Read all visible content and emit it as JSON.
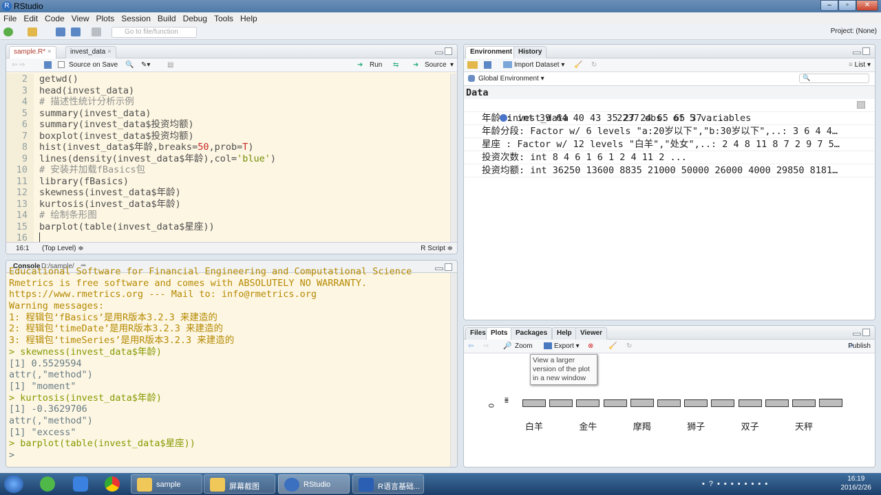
{
  "window": {
    "title": "RStudio"
  },
  "menu": [
    "File",
    "Edit",
    "Code",
    "View",
    "Plots",
    "Session",
    "Build",
    "Debug",
    "Tools",
    "Help"
  ],
  "toolbar": {
    "goto_placeholder": "Go to file/function",
    "project": "Project: (None)"
  },
  "editor": {
    "tabs": [
      {
        "label": "sample.R*",
        "active": true
      },
      {
        "label": "invest_data",
        "active": false
      }
    ],
    "source_on_save": "Source on Save",
    "run": "Run",
    "source": "Source",
    "lines": [
      {
        "n": "2",
        "parts": [
          [
            "cd",
            "getwd()"
          ]
        ]
      },
      {
        "n": "3",
        "parts": [
          [
            "cd",
            "head(invest_data)"
          ]
        ]
      },
      {
        "n": "4",
        "parts": [
          [
            "cm",
            "# 描述性统计分析示例"
          ]
        ]
      },
      {
        "n": "5",
        "parts": [
          [
            "cd",
            "summary(invest_data)"
          ]
        ]
      },
      {
        "n": "6",
        "parts": [
          [
            "cd",
            "summary(invest_data$投资均额)"
          ]
        ]
      },
      {
        "n": "7",
        "parts": [
          [
            "cd",
            "boxplot(invest_data$投资均额)"
          ]
        ]
      },
      {
        "n": "8",
        "parts": [
          [
            "cd",
            "hist(invest_data$年龄,breaks="
          ],
          [
            "nm",
            "50"
          ],
          [
            "cd",
            ",prob="
          ],
          [
            "nm",
            "T"
          ],
          [
            "cd",
            ")"
          ]
        ]
      },
      {
        "n": "9",
        "parts": [
          [
            "cd",
            "lines(density(invest_data$年龄),col="
          ],
          [
            "st",
            "'blue'"
          ],
          [
            "cd",
            ")"
          ]
        ]
      },
      {
        "n": "10",
        "parts": [
          [
            "cm",
            "# 安装并加载fBasics包"
          ]
        ]
      },
      {
        "n": "11",
        "parts": [
          [
            "cd",
            "library(fBasics)"
          ]
        ]
      },
      {
        "n": "12",
        "parts": [
          [
            "cd",
            "skewness(invest_data$年龄)"
          ]
        ]
      },
      {
        "n": "13",
        "parts": [
          [
            "cd",
            "kurtosis(invest_data$年龄)"
          ]
        ]
      },
      {
        "n": "14",
        "parts": [
          [
            "cm",
            "# 绘制条形图"
          ]
        ]
      },
      {
        "n": "15",
        "parts": [
          [
            "cd",
            "barplot(table(invest_data$星座))"
          ]
        ]
      },
      {
        "n": "16",
        "parts": [
          [
            "cd",
            ""
          ]
        ]
      }
    ],
    "status": {
      "position": "16:1",
      "scope": "(Top Level) ≑",
      "filetype": "R Script ≑"
    }
  },
  "console": {
    "title": "Console",
    "path": "D:/sample/",
    "lines": [
      [
        "msg",
        "Educational Software for Financial Engineering and Computational Science"
      ],
      [
        "msg",
        "Rmetrics is free software and comes with ABSOLUTELY NO WARRANTY."
      ],
      [
        "msg",
        "https://www.rmetrics.org --- Mail to: info@rmetrics.org"
      ],
      [
        "msg",
        "Warning messages:"
      ],
      [
        "msg",
        "1: 程辑包‘fBasics’是用R版本3.2.3 来建造的"
      ],
      [
        "msg",
        "2: 程辑包‘timeDate’是用R版本3.2.3 来建造的"
      ],
      [
        "msg",
        "3: 程辑包‘timeSeries’是用R版本3.2.3 来建造的"
      ],
      [
        "cmd",
        "> skewness(invest_data$年龄)"
      ],
      [
        "out",
        "[1] 0.5529594"
      ],
      [
        "out",
        "attr(,\"method\")"
      ],
      [
        "out",
        "[1] \"moment\""
      ],
      [
        "cmd",
        "> kurtosis(invest_data$年龄)"
      ],
      [
        "out",
        "[1] -0.3629706"
      ],
      [
        "out",
        "attr(,\"method\")"
      ],
      [
        "out",
        "[1] \"excess\""
      ],
      [
        "cmd",
        "> barplot(table(invest_data$星座))"
      ],
      [
        "out",
        "> "
      ]
    ]
  },
  "environment": {
    "tabs": [
      "Environment",
      "History"
    ],
    "import_dataset": "Import Dataset ▾",
    "list_view": "List ▾",
    "scope": "Global Environment ▾",
    "section": "Data",
    "object": {
      "name": "invest_data",
      "summary": "2237 obs. of 5 variables"
    },
    "vars": [
      "年龄 : int 39 64 40 43 35 27 24 65 65 37 ...",
      "年龄分段: Factor w/ 6 levels \"a:20岁以下\",\"b:30岁以下\",..: 3 6 4 4…",
      "星座 : Factor w/ 12 levels \"白羊\",\"处女\",..: 2 4 8 11 8 7 2 9 7 5…",
      "投资次数: int 8 4 6 1 6 1 2 4 11 2 ...",
      "投资均额: int 36250 13600 8835 21000 50000 26000 4000 29850 8181…"
    ]
  },
  "plots": {
    "tabs": [
      {
        "label": "Files",
        "active": false
      },
      {
        "label": "Plots",
        "active": true
      },
      {
        "label": "Packages",
        "active": false
      },
      {
        "label": "Help",
        "active": false
      },
      {
        "label": "Viewer",
        "active": false
      }
    ],
    "zoom": "Zoom",
    "export": "Export ▾",
    "publish": "Publish",
    "tooltip": "View a larger version of the plot in a new window",
    "y_tick": "0"
  },
  "chart_data": {
    "type": "bar",
    "title": "",
    "xlabel": "",
    "ylabel": "",
    "categories": [
      "白羊",
      "",
      "金牛",
      "",
      "摩羯",
      "",
      "狮子",
      "",
      "双子",
      "",
      "天秤",
      ""
    ],
    "visible_tick_labels": [
      "白羊",
      "金牛",
      "摩羯",
      "狮子",
      "双子",
      "天秤"
    ],
    "values": [
      190,
      190,
      185,
      180,
      195,
      185,
      190,
      190,
      190,
      190,
      190,
      195
    ],
    "ylim": [
      0,
      200
    ],
    "note": "plot pane is squashed; bar heights approximate"
  },
  "taskbar": {
    "items": [
      "sample",
      "屏幕截图",
      "RStudio",
      "R语言基础..."
    ],
    "time": "16:19",
    "date": "2016/2/26"
  }
}
